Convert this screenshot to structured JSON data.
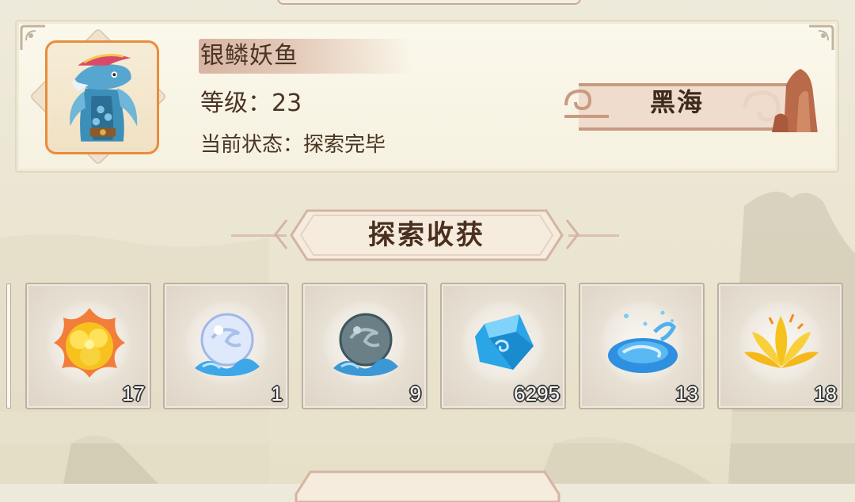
{
  "character": {
    "name": "银鳞妖鱼",
    "level_text": "等级：23",
    "status_text": "当前状态：探索完毕",
    "location": "黑海",
    "avatar_icon": "silver-scale-fish-demon-portrait"
  },
  "rewards_section": {
    "title": "探索收获"
  },
  "rewards": [
    {
      "icon": "golden-flame-flower-icon",
      "count": "17"
    },
    {
      "icon": "white-water-orb-icon",
      "count": "1"
    },
    {
      "icon": "dark-water-orb-icon",
      "count": "9"
    },
    {
      "icon": "blue-crystal-icon",
      "count": "6295"
    },
    {
      "icon": "blue-water-swirl-icon",
      "count": "13"
    },
    {
      "icon": "golden-lotus-icon",
      "count": "18"
    }
  ],
  "colors": {
    "avatar_border": "#e98c3c",
    "name_highlight": "#d8b4a2",
    "text": "#4a3524",
    "count_outline": "#3a3a3a"
  }
}
